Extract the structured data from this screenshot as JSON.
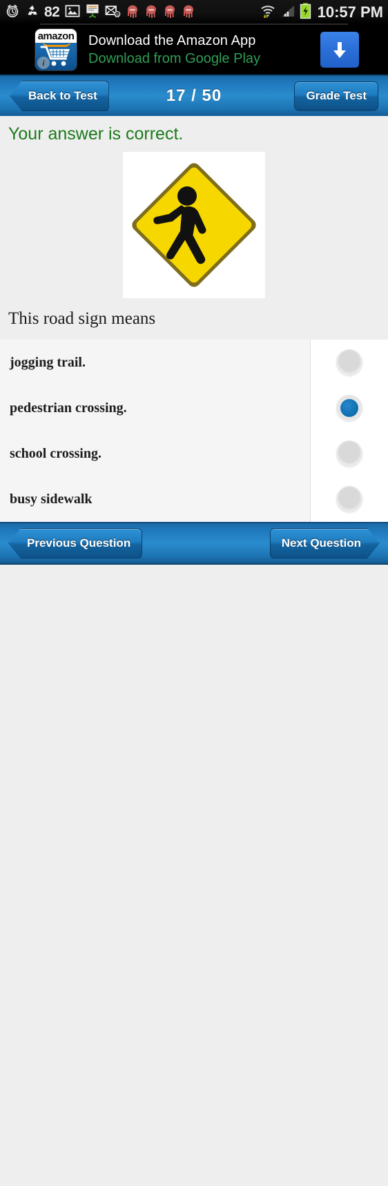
{
  "status_bar": {
    "icons": [
      "alarm-clock-icon",
      "recycle-icon",
      "gallery-icon",
      "presentation-icon",
      "mail-at-icon"
    ],
    "notification_count": "82",
    "notification_icons": [
      "octopus-icon",
      "octopus-icon",
      "octopus-icon",
      "octopus-icon"
    ],
    "right_icons": [
      "wifi-icon",
      "signal-bars-icon",
      "battery-charging-icon"
    ],
    "time": "10:57 PM",
    "notification_color": "#c85a56",
    "battery_color": "#97d92b"
  },
  "ad_banner": {
    "logo_label": "amazon",
    "info_label": "i",
    "headline": "Download the Amazon App",
    "subline": "Download from Google Play",
    "cta_icon": "download-arrow-icon",
    "cta_color": "#2a6fd8",
    "subline_color": "#2e9e55"
  },
  "header": {
    "back_label": "Back to Test",
    "counter": "17 / 50",
    "grade_label": "Grade Test"
  },
  "feedback": {
    "text": "Your answer is correct.",
    "color": "#1b7a1b"
  },
  "question": {
    "image": "pedestrian-crossing-sign",
    "sign_fill": "#f6d700",
    "sign_border": "#7a6a1a",
    "text": "This road sign means"
  },
  "options": [
    {
      "label": "jogging trail.",
      "selected": false
    },
    {
      "label": "pedestrian crossing.",
      "selected": true
    },
    {
      "label": "school crossing.",
      "selected": false
    },
    {
      "label": "busy sidewalk",
      "selected": false
    }
  ],
  "footer": {
    "previous_label": "Previous Question",
    "next_label": "Next Question"
  },
  "theme": {
    "accent_blue": "#1f7cc0",
    "selected_radio": "#1273b4",
    "page_bg": "#eeeeee"
  }
}
